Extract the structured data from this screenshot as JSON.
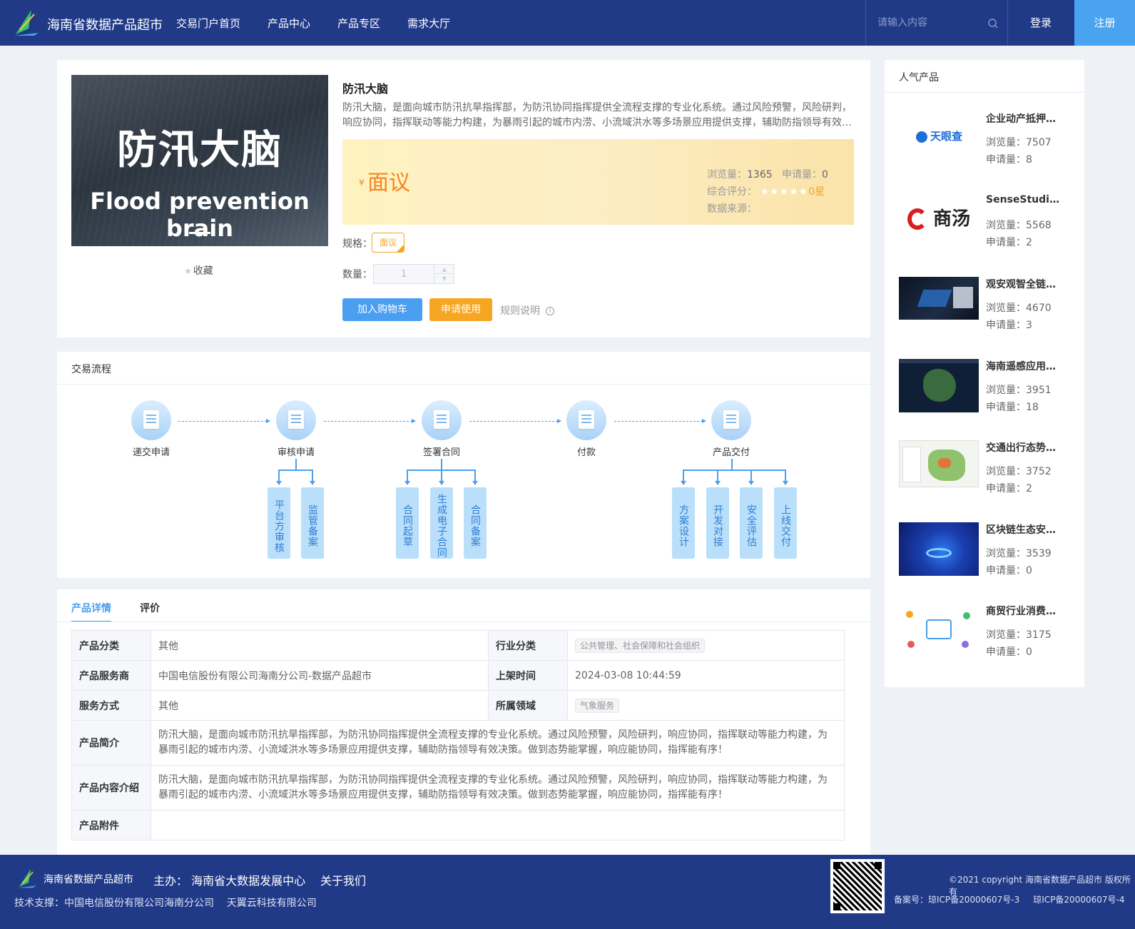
{
  "header": {
    "site_name": "海南省数据产品超市",
    "nav": [
      "交易门户首页",
      "产品中心",
      "产品专区",
      "需求大厅"
    ],
    "search_placeholder": "请输入内容",
    "login": "登录",
    "register": "注册"
  },
  "product": {
    "image_title": "防汛大脑",
    "image_subtitle": "Flood prevention brain",
    "favorite": "收藏",
    "title": "防汛大脑",
    "desc": "防汛大脑，是面向城市防汛抗旱指挥部，为防汛协同指挥提供全流程支撑的专业化系统。通过风险预警，风险研判，响应协同，指挥联动等能力构建，为暴雨引起的城市内涝、小流域洪水等多场景应用提供支撑，辅助防指领导有效…",
    "currency": "¥",
    "price": "面议",
    "views_label": "浏览量：",
    "views": "1365",
    "apply_label": "申请量：",
    "apply": "0",
    "rating_label": "综合评分：",
    "rating": 0,
    "rating_text": "0星",
    "source_label": "数据来源：",
    "spec_label": "规格：",
    "spec": "面议",
    "qty_label": "数量：",
    "qty": "1",
    "btn_cart": "加入购物车",
    "btn_apply": "申请使用",
    "rules": "规则说明"
  },
  "process": {
    "title": "交易流程",
    "steps": [
      "递交申请",
      "审核申请",
      "签署合同",
      "付款",
      "产品交付"
    ],
    "sub": {
      "review": [
        "平台方审核",
        "监管备案"
      ],
      "contract": [
        "合同起草",
        "生成电子合同",
        "合同备案"
      ],
      "delivery": [
        "方案设计",
        "开发对接",
        "安全评估",
        "上线交付"
      ]
    }
  },
  "detail": {
    "tabs": [
      "产品详情",
      "评价"
    ],
    "rows": {
      "category_k": "产品分类",
      "category_v": "其他",
      "industry_k": "行业分类",
      "industry_v": "公共管理、社会保障和社会组织",
      "provider_k": "产品服务商",
      "provider_v": "中国电信股份有限公司海南分公司-数据产品超市",
      "listed_k": "上架时间",
      "listed_v": "2024-03-08 10:44:59",
      "service_k": "服务方式",
      "service_v": "其他",
      "domain_k": "所属领域",
      "domain_v": "气象服务",
      "intro_k": "产品简介",
      "intro_v": "防汛大脑，是面向城市防汛抗旱指挥部，为防汛协同指挥提供全流程支撑的专业化系统。通过风险预警，风险研判，响应协同，指挥联动等能力构建，为暴雨引起的城市内涝、小流域洪水等多场景应用提供支撑，辅助防指领导有效决策。做到态势能掌握，响应能协同，指挥能有序！",
      "content_k": "产品内容介绍",
      "content_v": "防汛大脑，是面向城市防汛抗旱指挥部，为防汛协同指挥提供全流程支撑的专业化系统。通过风险预警，风险研判，响应协同，指挥联动等能力构建，为暴雨引起的城市内涝、小流域洪水等多场景应用提供支撑，辅助防指领导有效决策。做到态势能掌握，响应能协同，指挥能有序！",
      "attach_k": "产品附件",
      "attach_v": ""
    }
  },
  "popular": {
    "title": "人气产品",
    "views_label": "浏览量：",
    "apply_label": "申请量：",
    "items": [
      {
        "name": "企业动产抵押…",
        "views": "7507",
        "apply": "8",
        "thumb_text": "天眼查"
      },
      {
        "name": "SenseStudio…",
        "views": "5568",
        "apply": "2",
        "thumb_text": "商汤"
      },
      {
        "name": "观安观智全链…",
        "views": "4670",
        "apply": "3",
        "thumb_text": ""
      },
      {
        "name": "海南遥感应用…",
        "views": "3951",
        "apply": "18",
        "thumb_text": ""
      },
      {
        "name": "交通出行态势…",
        "views": "3752",
        "apply": "2",
        "thumb_text": ""
      },
      {
        "name": "区块链生态安…",
        "views": "3539",
        "apply": "0",
        "thumb_text": ""
      },
      {
        "name": "商贸行业消费…",
        "views": "3175",
        "apply": "0",
        "thumb_text": ""
      }
    ]
  },
  "footer": {
    "name": "海南省数据产品超市",
    "host": "主办： 海南省大数据发展中心",
    "about": "关于我们",
    "support": "技术支撑：中国电信股份有限公司海南分公司    天翼云科技有限公司",
    "copyright": "©2021 copyright 海南省数据产品超市 版权所有",
    "icp": "备案号：琼ICP备20000607号-3     琼ICP备20000607号-4"
  },
  "colors": {
    "header_bg": "#213a87",
    "accent_blue": "#4a9ff0",
    "accent_orange": "#f5a623",
    "price_orange": "#f5871e"
  }
}
